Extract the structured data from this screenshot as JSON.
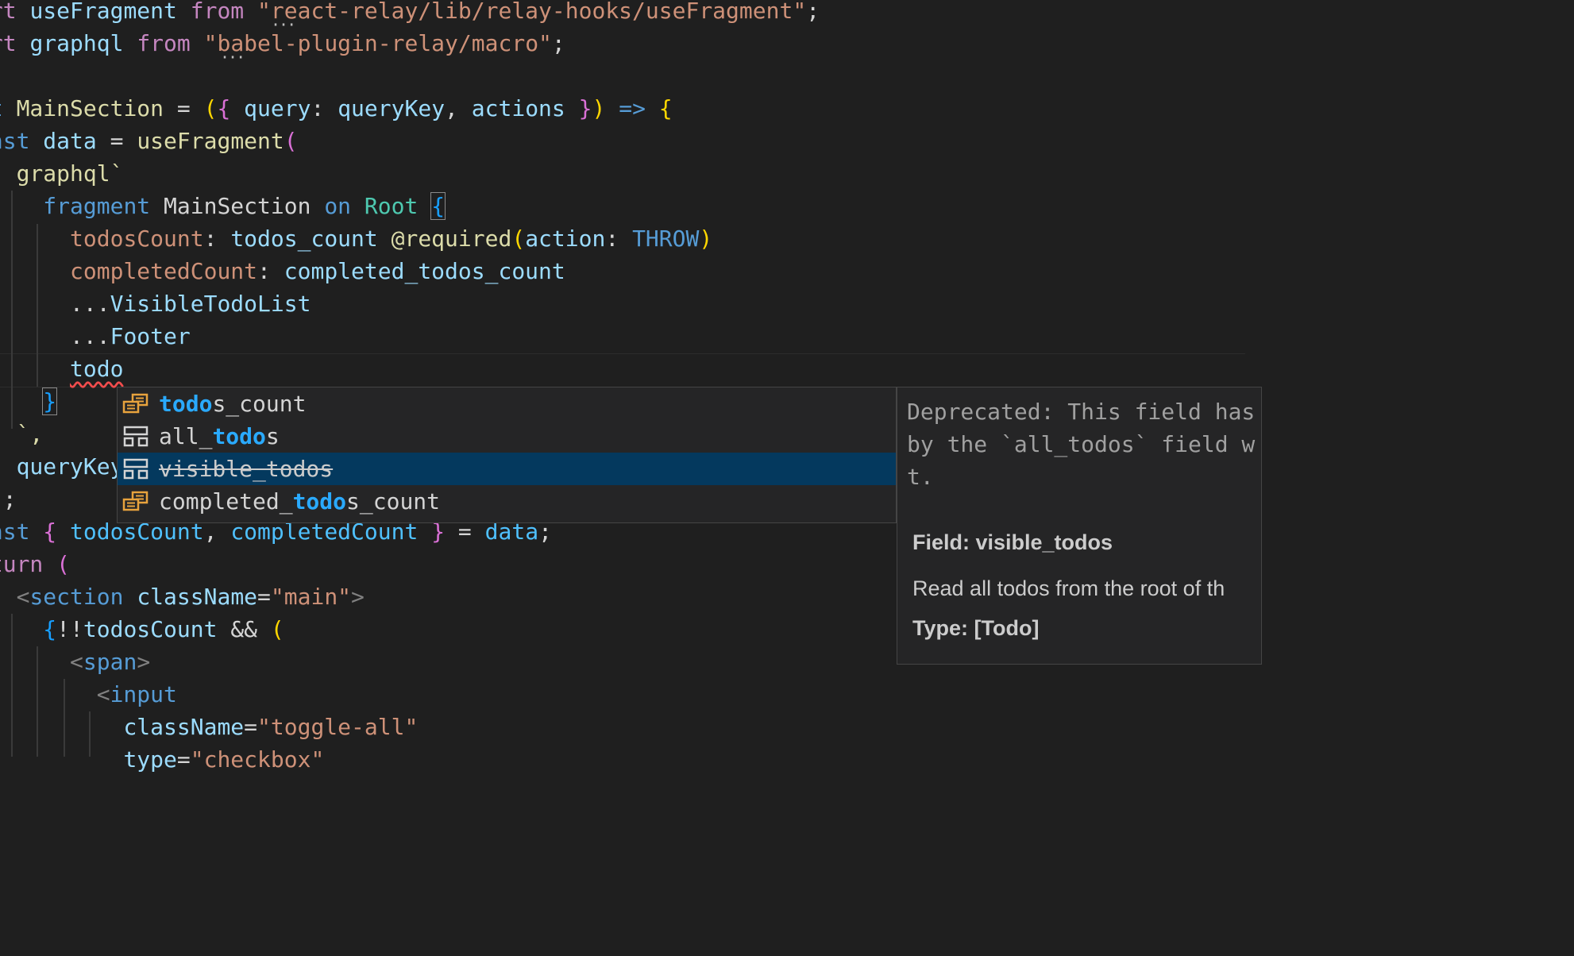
{
  "code_lines": {
    "l1": {
      "a": "ort",
      "b": "useFragment",
      "c": "from",
      "d": "\"react-relay/lib/relay-hooks/useFragment\"",
      "e": ";"
    },
    "l2": {
      "a": "ort",
      "b": "graphql",
      "c": "from",
      "d": "\"babel-plugin-relay/macro\"",
      "e": ";"
    },
    "l4": {
      "a": "st",
      "b": "MainSection",
      "c": "=",
      "d": "(",
      "e": "{",
      "f": "query",
      "g": ":",
      "h": "queryKey",
      "i": ",",
      "j": "actions",
      "k": "}",
      "l": ")",
      "m": "=>",
      "n": "{"
    },
    "l5": {
      "a": "onst",
      "b": "data",
      "c": "=",
      "d": "useFragment",
      "e": "("
    },
    "l6": {
      "a": "graphql`"
    },
    "l7": {
      "a": "fragment",
      "b": "MainSection",
      "c": "on",
      "d": "Root",
      "e": "{"
    },
    "l8": {
      "a": "todosCount",
      "b": ":",
      "c": "todos_count",
      "d": "@required",
      "e": "(",
      "f": "action",
      "g": ":",
      "h": "THROW",
      "i": ")"
    },
    "l9": {
      "a": "completedCount",
      "b": ":",
      "c": "completed_todos_count"
    },
    "l10": {
      "a": "...",
      "b": "VisibleTodoList"
    },
    "l11": {
      "a": "...",
      "b": "Footer"
    },
    "l12": {
      "a": "todo"
    },
    "l13": {
      "a": "}"
    },
    "l14": {
      "a": "`,"
    },
    "l15": {
      "a": "queryKey"
    },
    "l16": {
      "a": ";"
    },
    "l17": {
      "a": "onst",
      "b": "{",
      "c": "todosCount",
      "d": ",",
      "e": "completedCount",
      "f": "}",
      "g": "=",
      "h": "data",
      "i": ";"
    },
    "l18": {
      "a": "eturn",
      "b": "("
    },
    "l19": {
      "a": "<",
      "b": "section",
      "c": "className",
      "d": "=",
      "e": "\"main\"",
      "f": ">"
    },
    "l20": {
      "a": "{",
      "b": "!!",
      "c": "todosCount",
      "d": "&&",
      "e": "("
    },
    "l21": {
      "a": "<",
      "b": "span",
      "c": ">"
    },
    "l22": {
      "a": "<",
      "b": "input"
    },
    "l23": {
      "a": "className",
      "b": "=",
      "c": "\"toggle-all\""
    },
    "l24": {
      "a": "type",
      "b": "=",
      "c": "\"checkbox\""
    }
  },
  "suggest": {
    "items": [
      {
        "icon": "field-icon",
        "match": "todo",
        "rest": "s_count"
      },
      {
        "icon": "object-icon",
        "prefix": "all_",
        "match": "todo",
        "rest": "s"
      },
      {
        "icon": "object-icon",
        "label": "visible_todos",
        "deprecated": true,
        "selected": true
      },
      {
        "icon": "field-icon",
        "prefix": "completed_",
        "match": "todo",
        "rest": "s_count"
      }
    ]
  },
  "details": {
    "deprecation_line1": "Deprecated: This field has",
    "deprecation_line2": "by the `all_todos` field w",
    "deprecation_line3": "t.",
    "field_heading": "Field: visible_todos",
    "description": "Read all todos from the root of th",
    "type_line": "Type: [Todo]"
  },
  "colors": {
    "background": "#1f1f1f",
    "selection": "#04395e",
    "match_highlight": "#2aaaff",
    "field_icon": "#e8a33d"
  }
}
